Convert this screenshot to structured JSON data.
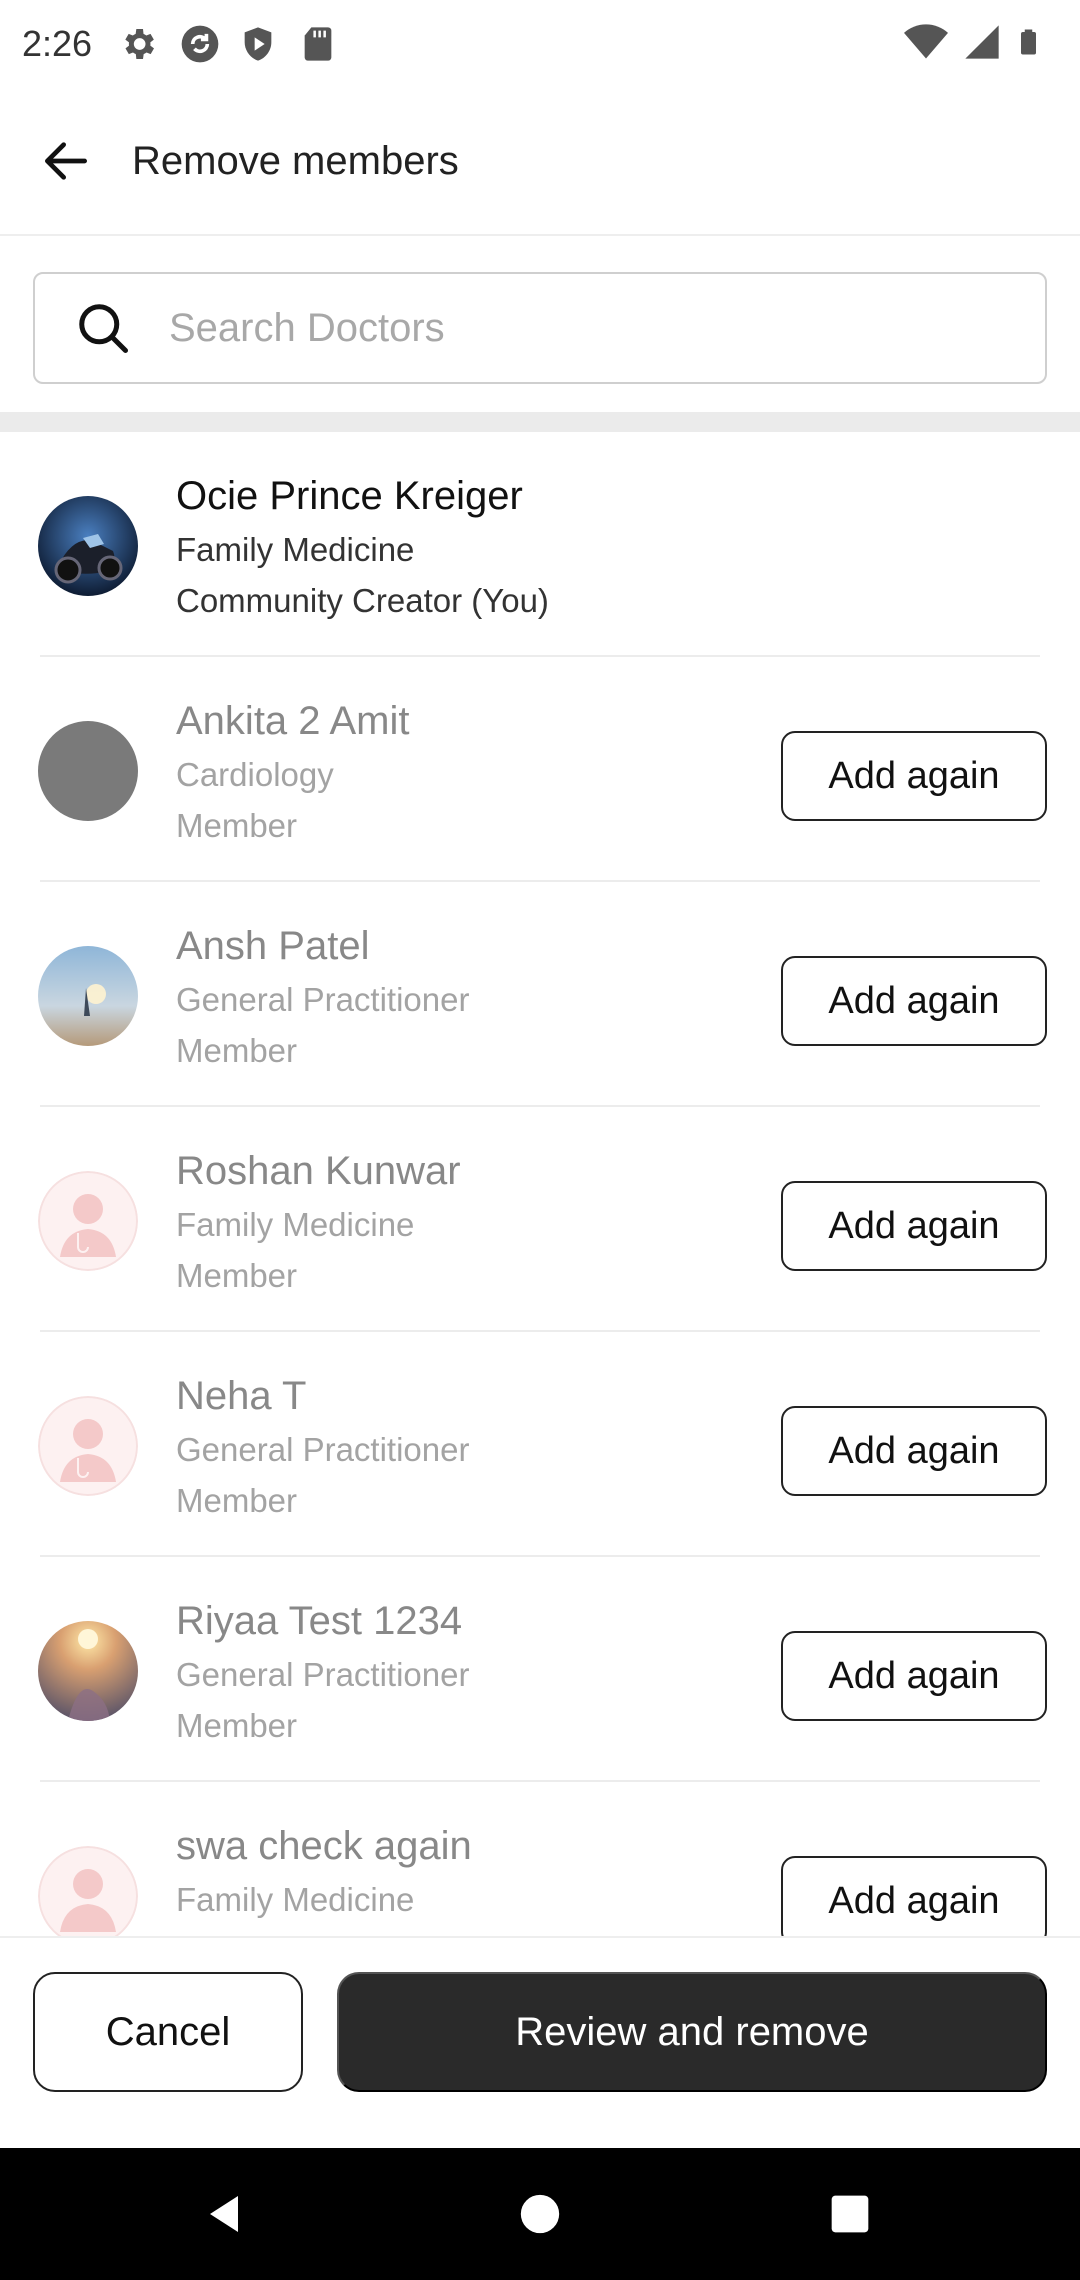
{
  "status_bar": {
    "time": "2:26",
    "left_icons": [
      "gear-icon",
      "sync-icon",
      "shield-icon",
      "sd-card-icon"
    ],
    "right_icons": [
      "wifi-icon",
      "signal-icon",
      "battery-icon"
    ]
  },
  "app_bar": {
    "title": "Remove members",
    "back_icon": "arrow-left-icon"
  },
  "search": {
    "placeholder": "Search Doctors",
    "value": ""
  },
  "members": [
    {
      "name": "Ocie Prince Kreiger",
      "specialty": "Family Medicine",
      "role": "Community Creator (You)",
      "avatar": "motorcycle-photo",
      "state": "creator"
    },
    {
      "name": "Ankita 2 Amit",
      "specialty": "Cardiology",
      "role": "Member",
      "avatar": "gray-placeholder",
      "state": "removed",
      "action_label": "Add again"
    },
    {
      "name": "Ansh Patel",
      "specialty": "General Practitioner",
      "role": "Member",
      "avatar": "sky-photo",
      "state": "removed",
      "action_label": "Add again"
    },
    {
      "name": "Roshan Kunwar",
      "specialty": "Family Medicine",
      "role": "Member",
      "avatar": "doctor-placeholder",
      "state": "removed",
      "action_label": "Add again"
    },
    {
      "name": "Neha T",
      "specialty": "General Practitioner",
      "role": "Member",
      "avatar": "doctor-placeholder",
      "state": "removed",
      "action_label": "Add again"
    },
    {
      "name": "Riyaa Test 1234",
      "specialty": "General Practitioner",
      "role": "Member",
      "avatar": "sunset-photo",
      "state": "removed",
      "action_label": "Add again"
    },
    {
      "name": "swa check again",
      "specialty": "Family Medicine",
      "role": "",
      "avatar": "doctor-placeholder",
      "state": "removed",
      "action_label": "Add again"
    }
  ],
  "footer": {
    "cancel_label": "Cancel",
    "review_label": "Review and remove"
  },
  "nav": [
    "back-icon",
    "home-icon",
    "recents-icon"
  ],
  "colors": {
    "primary_button": "#2a2a2a",
    "muted_text": "#888888",
    "divider": "#ebebeb"
  }
}
